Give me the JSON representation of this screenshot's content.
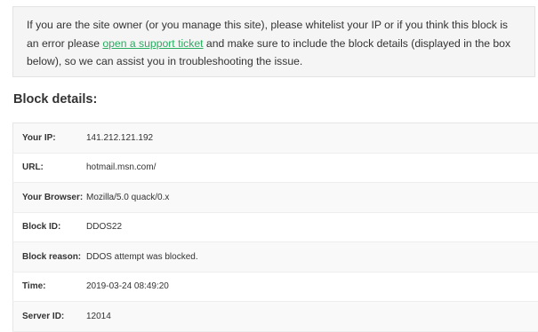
{
  "notice": {
    "text_before_link": "If you are the site owner (or you manage this site), please whitelist your IP or if you think this block is an error please ",
    "link_text": "open a support ticket",
    "text_after_link": " and make sure to include the block details (displayed in the box below), so we can assist you in troubleshooting the issue."
  },
  "block_details": {
    "heading": "Block details:",
    "rows": [
      {
        "label": "Your IP:",
        "value": "141.212.121.192"
      },
      {
        "label": "URL:",
        "value": "hotmail.msn.com/"
      },
      {
        "label": "Your Browser:",
        "value": "Mozilla/5.0 quack/0.x"
      },
      {
        "label": "Block ID:",
        "value": "DDOS22"
      },
      {
        "label": "Block reason:",
        "value": "DDOS attempt was blocked."
      },
      {
        "label": "Time:",
        "value": "2019-03-24 08:49:20"
      },
      {
        "label": "Server ID:",
        "value": "12014"
      }
    ]
  },
  "colors": {
    "link": "#27ae60",
    "notice_background": "#f5f5f5",
    "row_alt_background": "#f9f9f9"
  }
}
